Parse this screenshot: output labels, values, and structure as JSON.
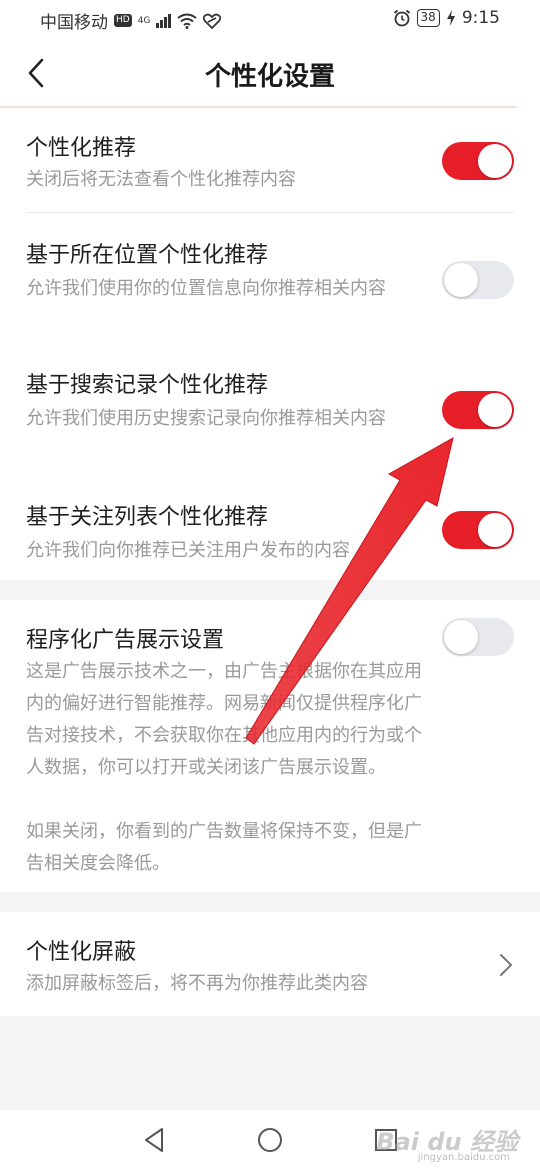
{
  "status_bar": {
    "carrier": "中国移动",
    "hd": "HD",
    "network": "4G",
    "battery": "38",
    "time": "9:15"
  },
  "header": {
    "title": "个性化设置"
  },
  "settings": [
    {
      "title": "个性化推荐",
      "desc": "关闭后将无法查看个性化推荐内容",
      "enabled": true
    },
    {
      "title": "基于所在位置个性化推荐",
      "desc": "允许我们使用你的位置信息向你推荐相关内容",
      "enabled": false
    },
    {
      "title": "基于搜索记录个性化推荐",
      "desc": "允许我们使用历史搜索记录向你推荐相关内容",
      "enabled": true
    },
    {
      "title": "基于关注列表个性化推荐",
      "desc": "允许我们向你推荐已关注用户发布的内容",
      "enabled": true
    }
  ],
  "ad_setting": {
    "title": "程序化广告展示设置",
    "desc1": "这是广告展示技术之一，由广告主根据你在其应用内的偏好进行智能推荐。网易新闻仅提供程序化广告对接技术，不会获取你在其他应用内的行为或个人数据，你可以打开或关闭该广告展示设置。",
    "desc2": "如果关闭，你看到的广告数量将保持不变，但是广告相关度会降低。",
    "enabled": false
  },
  "block_setting": {
    "title": "个性化屏蔽",
    "desc": "添加屏蔽标签后，将不再为你推荐此类内容"
  },
  "watermark": {
    "brand": "Bai du 经验",
    "url": "jingyan.baidu.com"
  },
  "colors": {
    "accent": "#e61e28",
    "toggle_off": "#e8e9ee",
    "annotation_arrow": "#e8262c"
  }
}
